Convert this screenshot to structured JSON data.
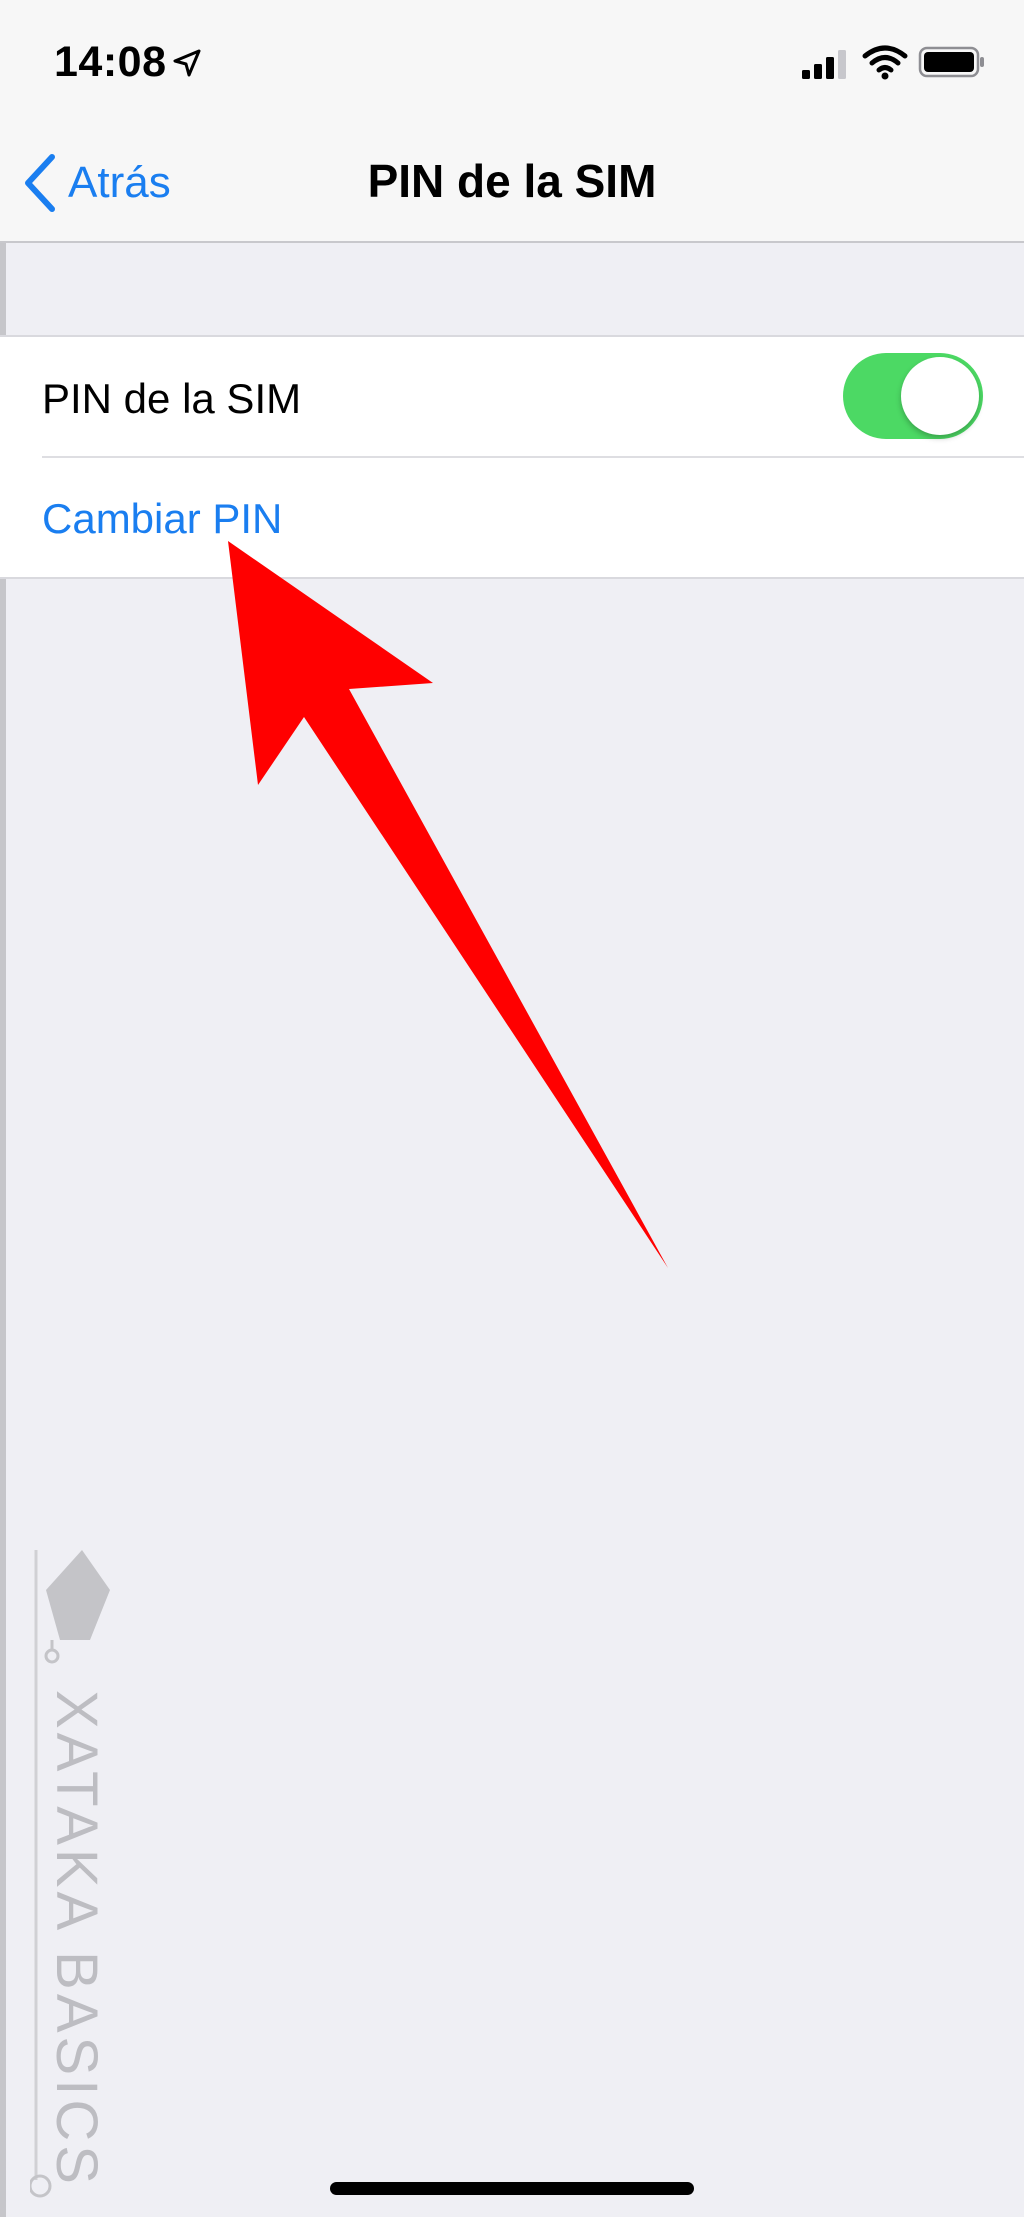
{
  "status_bar": {
    "time": "14:08",
    "icons": [
      "location-arrow-icon",
      "cellular-signal-icon",
      "wifi-icon",
      "battery-icon"
    ]
  },
  "nav": {
    "back_label": "Atrás",
    "title": "PIN de la SIM"
  },
  "settings": {
    "sim_pin_label": "PIN de la SIM",
    "sim_pin_enabled": true,
    "change_pin_label": "Cambiar PIN"
  },
  "watermark": {
    "text": "XATAKA BASICS"
  },
  "colors": {
    "accent": "#1a7ef0",
    "toggle_on": "#4cd964",
    "arrow": "#ff0000",
    "background": "#efeff4"
  }
}
